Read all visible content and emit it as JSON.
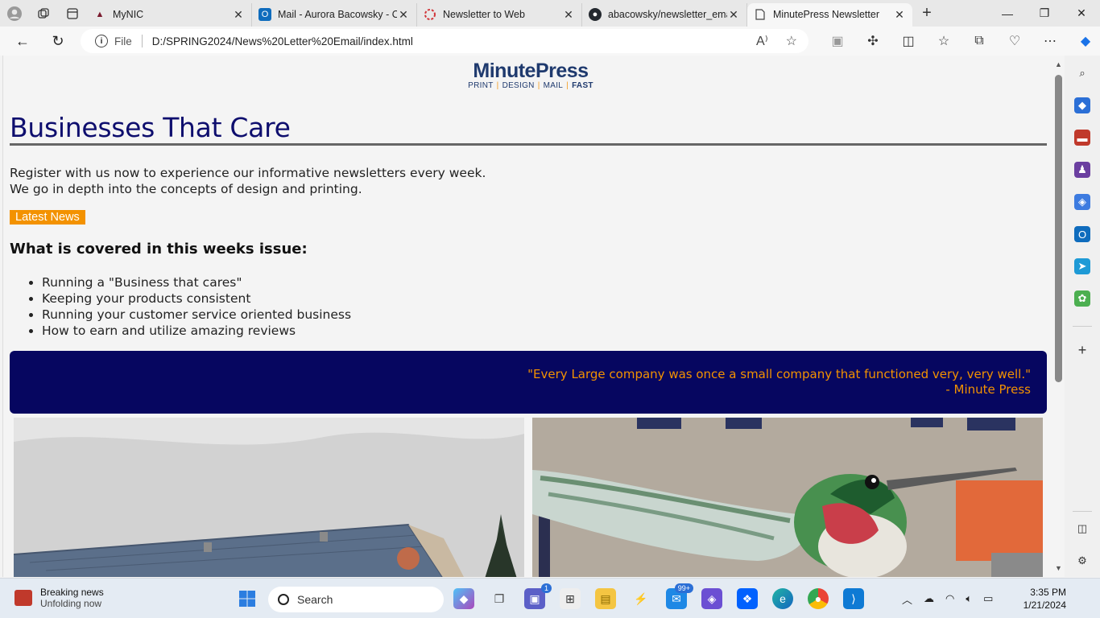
{
  "browser": {
    "tabs": [
      {
        "title": "MyNIC",
        "favicon": "mynic-icon",
        "color": "#7a1b2e"
      },
      {
        "title": "Mail - Aurora Bacowsky - Outlook",
        "favicon": "outlook-icon",
        "color": "#0f6cbd"
      },
      {
        "title": "Newsletter to Web",
        "favicon": "loading-icon",
        "color": "#d13438"
      },
      {
        "title": "abacowsky/newsletter_email",
        "favicon": "github-icon",
        "color": "#24292f"
      },
      {
        "title": "MinutePress Newsletter",
        "favicon": "page-icon",
        "color": "#555555"
      }
    ],
    "address": {
      "scheme_label": "File",
      "url": "D:/SPRING2024/News%20Letter%20Email/index.html"
    }
  },
  "page": {
    "logo": {
      "name": "MinutePress",
      "tag_print": "PRINT",
      "tag_design": "DESIGN",
      "tag_mail": "MAIL",
      "tag_fast": "FAST",
      "sep": "|"
    },
    "heading": "Businesses That Care",
    "intro_line1": "Register with us now to experience our informative newsletters every week.",
    "intro_line2": "We go in depth into the concepts of design and printing.",
    "latest_button": "Latest News",
    "subheading": "What is covered in this weeks issue:",
    "topics": [
      "Running a \"Business that cares\"",
      "Keeping your products consistent",
      "Running your customer service oriented business",
      "How to earn and utilize amazing reviews"
    ],
    "quote": "\"Every Large company was once a small company that functioned very, very well.\"",
    "quote_author": "- Minute Press",
    "colors": {
      "heading": "#0e0e6e",
      "accent": "#f39200",
      "quote_bg": "#060660"
    }
  },
  "taskbar": {
    "news_title": "Breaking news",
    "news_sub": "Unfolding now",
    "search_placeholder": "Search",
    "teams_badge": "1",
    "mail_badge": "99+",
    "time": "3:35 PM",
    "date": "1/21/2024"
  }
}
